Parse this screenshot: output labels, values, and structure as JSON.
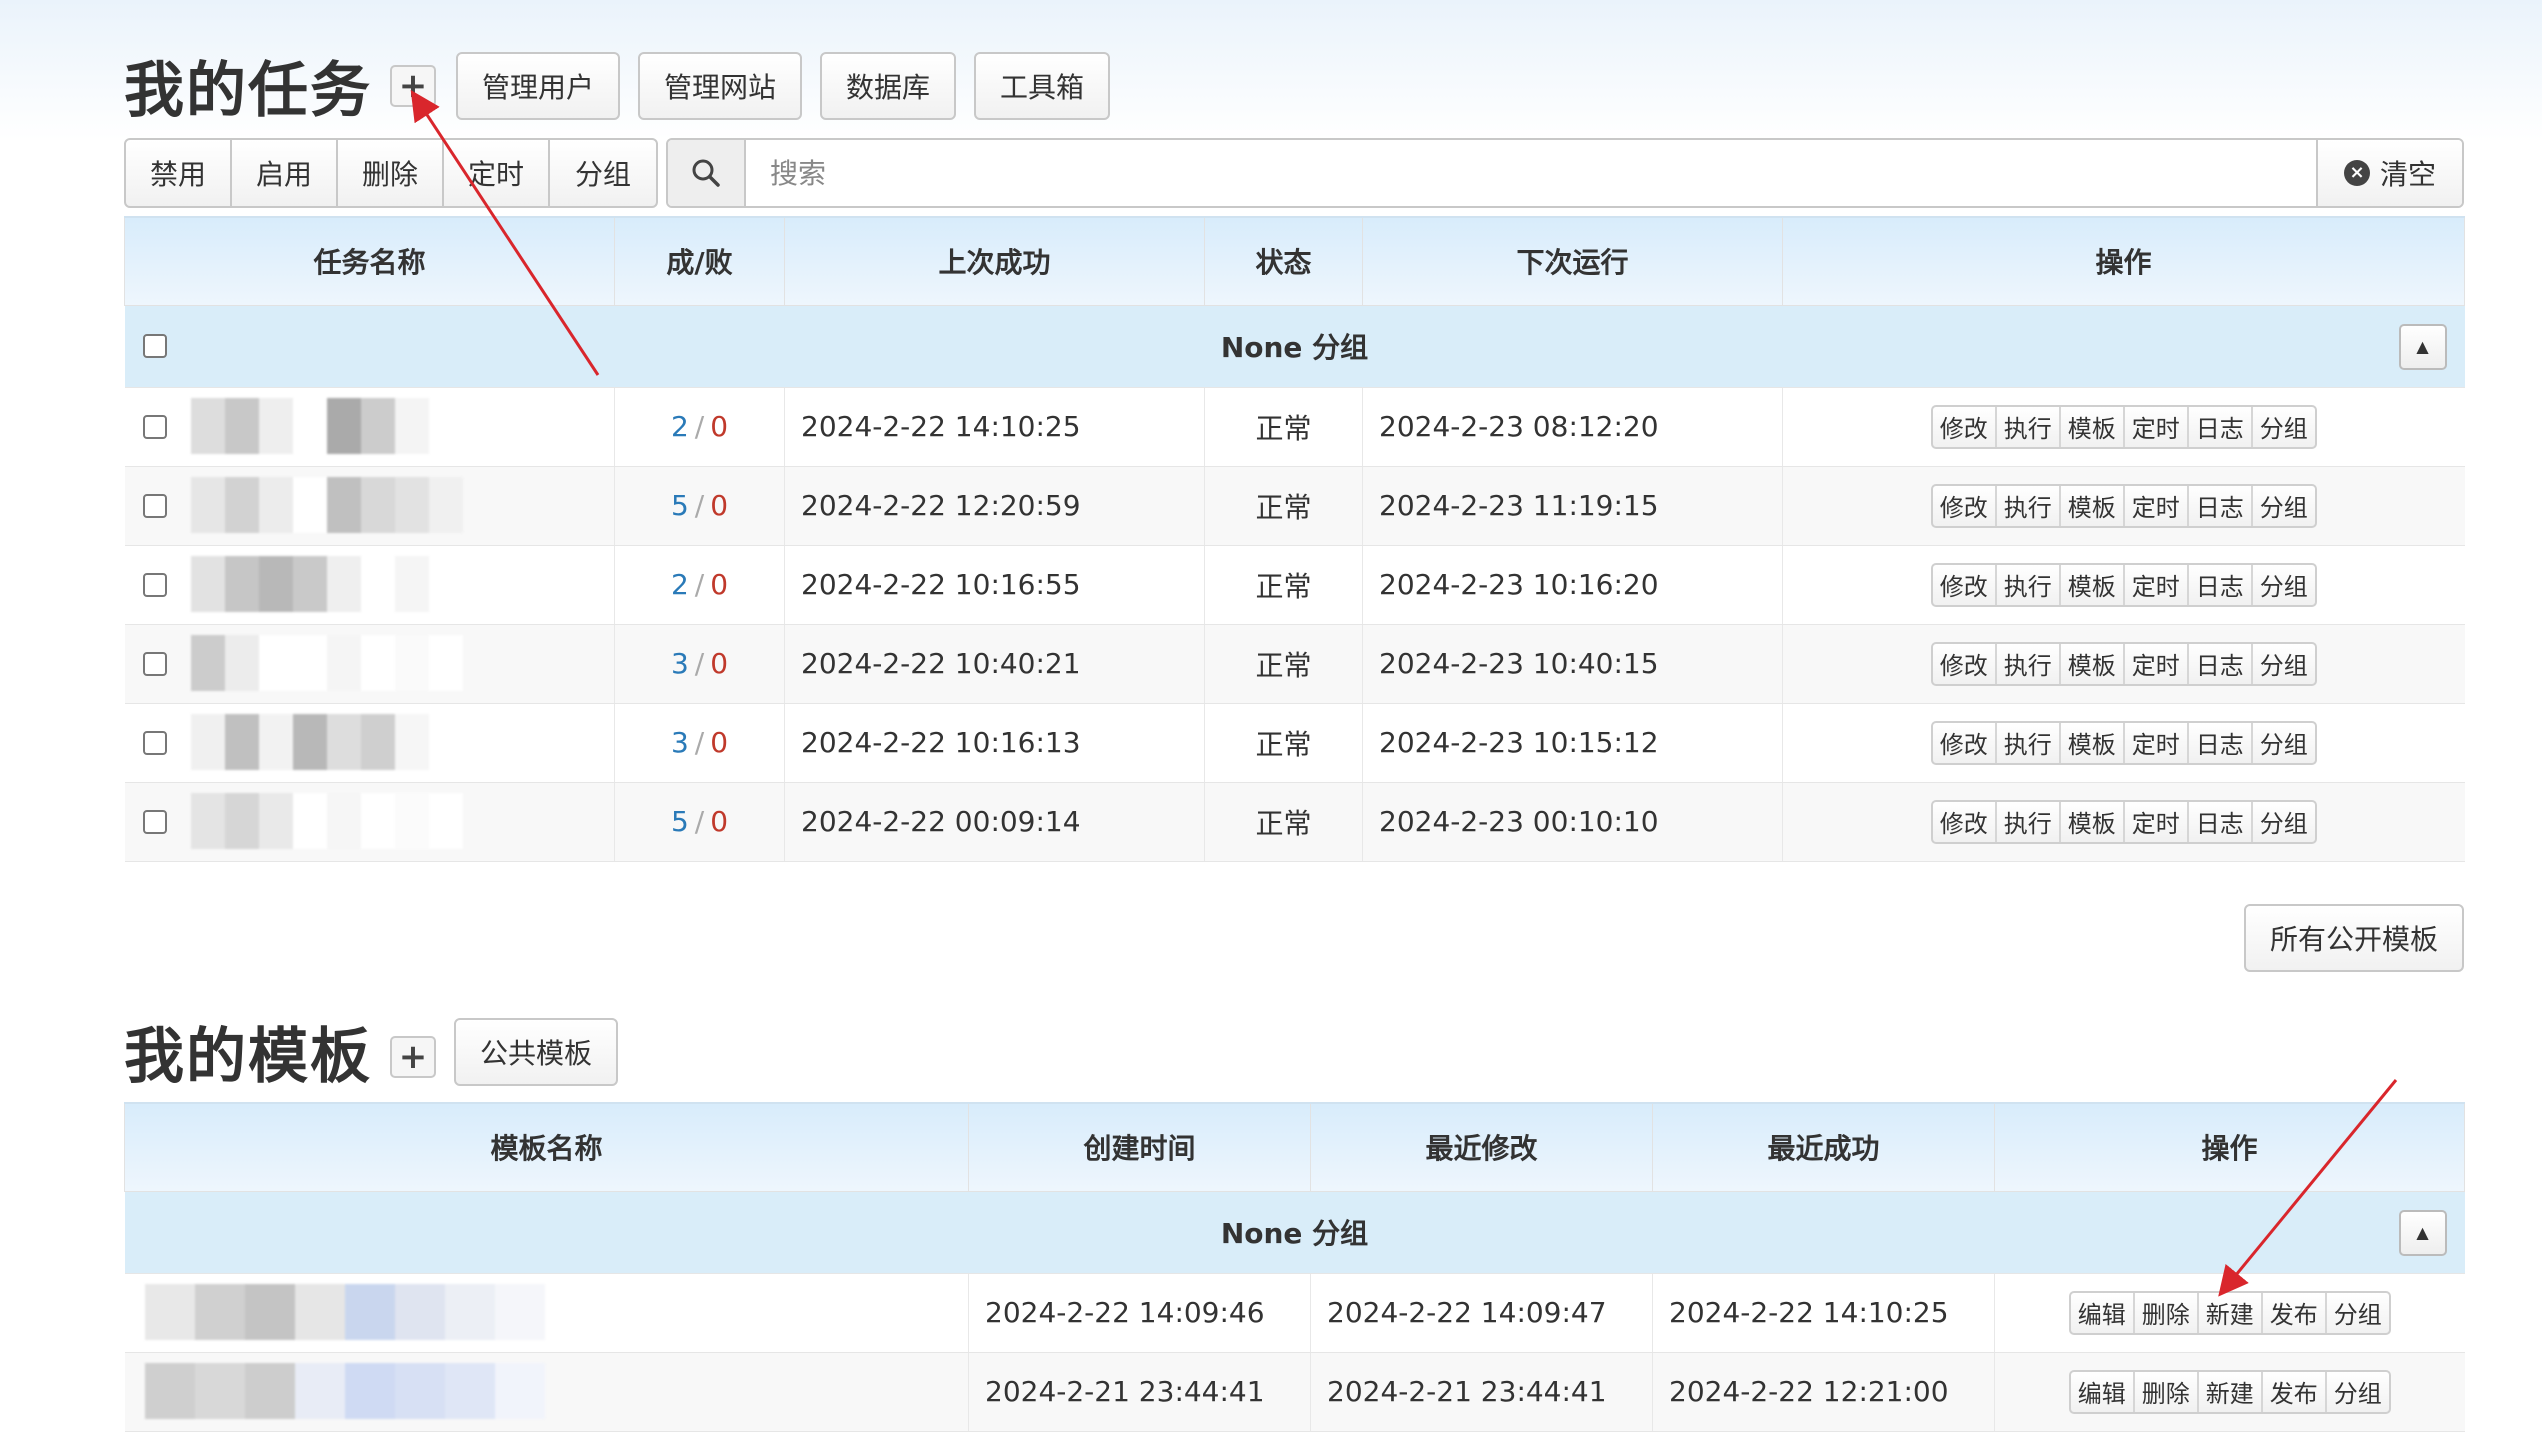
{
  "tasks_section": {
    "title": "我的任务",
    "add_icon": "plus-icon",
    "header_buttons": [
      "管理用户",
      "管理网站",
      "数据库",
      "工具箱"
    ]
  },
  "toolbar": {
    "actions": [
      "禁用",
      "启用",
      "删除",
      "定时",
      "分组"
    ],
    "search_icon": "search-icon",
    "search_placeholder": "搜索",
    "clear_label": "清空",
    "clear_icon": "close-circle-icon"
  },
  "tasks_table": {
    "columns": [
      "任务名称",
      "成/败",
      "上次成功",
      "状态",
      "下次运行",
      "操作"
    ],
    "group_label": "None 分组",
    "row_actions": [
      "修改",
      "执行",
      "模板",
      "定时",
      "日志",
      "分组"
    ],
    "rows": [
      {
        "success": "2",
        "fail": "0",
        "last_success": "2024-2-22 14:10:25",
        "status": "正常",
        "next_run": "2024-2-23 08:12:20"
      },
      {
        "success": "5",
        "fail": "0",
        "last_success": "2024-2-22 12:20:59",
        "status": "正常",
        "next_run": "2024-2-23 11:19:15"
      },
      {
        "success": "2",
        "fail": "0",
        "last_success": "2024-2-22 10:16:55",
        "status": "正常",
        "next_run": "2024-2-23 10:16:20"
      },
      {
        "success": "3",
        "fail": "0",
        "last_success": "2024-2-22 10:40:21",
        "status": "正常",
        "next_run": "2024-2-23 10:40:15"
      },
      {
        "success": "3",
        "fail": "0",
        "last_success": "2024-2-22 10:16:13",
        "status": "正常",
        "next_run": "2024-2-23 10:15:12"
      },
      {
        "success": "5",
        "fail": "0",
        "last_success": "2024-2-22 00:09:14",
        "status": "正常",
        "next_run": "2024-2-23 00:10:10"
      }
    ]
  },
  "public_templates_button": "所有公开模板",
  "templates_section": {
    "title": "我的模板",
    "add_icon": "plus-icon",
    "public_button": "公共模板"
  },
  "templates_table": {
    "columns": [
      "模板名称",
      "创建时间",
      "最近修改",
      "最近成功",
      "操作"
    ],
    "group_label": "None 分组",
    "row_actions": [
      "编辑",
      "删除",
      "新建",
      "发布",
      "分组"
    ],
    "rows": [
      {
        "created": "2024-2-22 14:09:46",
        "modified": "2024-2-22 14:09:47",
        "last_success": "2024-2-22 14:10:25"
      },
      {
        "created": "2024-2-21 23:44:41",
        "modified": "2024-2-21 23:44:41",
        "last_success": "2024-2-22 12:21:00"
      }
    ]
  },
  "colors": {
    "success_count": "#2a7ab8",
    "fail_count": "#c0392b",
    "header_bg": "#d8ecfb",
    "group_bg": "#d9edf9",
    "annotation_arrow": "#d9262c"
  }
}
